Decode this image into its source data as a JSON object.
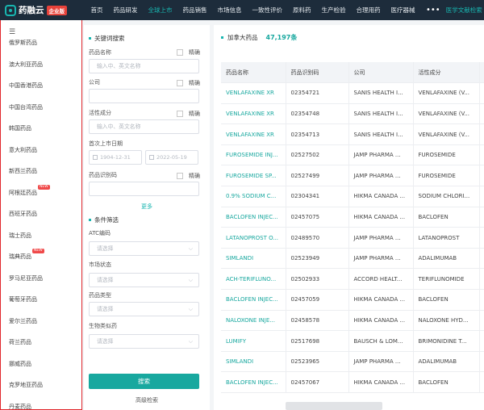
{
  "app": {
    "logo_text": "药融云",
    "logo_badge": "企业版"
  },
  "topnav": {
    "items": [
      {
        "label": "首页",
        "active": false
      },
      {
        "label": "药品研发",
        "active": false
      },
      {
        "label": "全球上市",
        "active": true
      },
      {
        "label": "药品销售",
        "active": false
      },
      {
        "label": "市场信息",
        "active": false
      },
      {
        "label": "一致性评价",
        "active": false
      },
      {
        "label": "原料药",
        "active": false
      },
      {
        "label": "生产检验",
        "active": false
      },
      {
        "label": "合理用药",
        "active": false
      },
      {
        "label": "医疗器械",
        "active": false
      }
    ],
    "more": "•••",
    "right_link": "医学文献检索"
  },
  "sidebar": {
    "menu_icon": "menu-icon",
    "countries": [
      {
        "label": "俄罗斯药品",
        "new": false
      },
      {
        "label": "澳大利亚药品",
        "new": false
      },
      {
        "label": "中国香港药品",
        "new": false
      },
      {
        "label": "中国台湾药品",
        "new": false
      },
      {
        "label": "韩国药品",
        "new": false
      },
      {
        "label": "意大利药品",
        "new": false
      },
      {
        "label": "新西兰药品",
        "new": false
      },
      {
        "label": "阿根廷药品",
        "new": true
      },
      {
        "label": "西班牙药品",
        "new": false
      },
      {
        "label": "瑞士药品",
        "new": false
      },
      {
        "label": "瑞典药品",
        "new": true
      },
      {
        "label": "罗马尼亚药品",
        "new": false
      },
      {
        "label": "葡萄牙药品",
        "new": false
      },
      {
        "label": "爱尔兰药品",
        "new": false
      },
      {
        "label": "荷兰药品",
        "new": false
      },
      {
        "label": "挪威药品",
        "new": false
      },
      {
        "label": "克罗地亚药品",
        "new": false
      },
      {
        "label": "丹麦药品",
        "new": false
      }
    ],
    "new_badge": "NEW"
  },
  "search": {
    "keyword_heading": "关键词搜索",
    "exact_label": "精确",
    "drug_name_label": "药品名称",
    "drug_name_placeholder": "输入中、英文名称",
    "company_label": "公司",
    "company_value": "",
    "ingredient_label": "活性成分",
    "ingredient_placeholder": "输入中、英文名称",
    "first_listing_label": "首次上市日期",
    "date_from": "1904-12-31",
    "date_to": "2022-05-19",
    "drug_id_label": "药品识别码",
    "drug_id_value": "",
    "more_label": "更多",
    "filter_heading": "条件筛选",
    "atc_label": "ATC编码",
    "market_status_label": "市场状态",
    "drug_type_label": "药品类型",
    "biosimilar_label": "生物类似药",
    "select_placeholder": "请选择",
    "search_button": "搜索",
    "advanced_link": "高级检索"
  },
  "results": {
    "title": "加拿大药品",
    "count": "47,197条",
    "columns": [
      "药品名称",
      "药品识别码",
      "公司",
      "活性成分"
    ],
    "rows": [
      [
        "VENLAFAXINE XR",
        "02354721",
        "SANIS HEALTH I...",
        "VENLAFAXINE (V..."
      ],
      [
        "VENLAFAXINE XR",
        "02354748",
        "SANIS HEALTH I...",
        "VENLAFAXINE (V..."
      ],
      [
        "VENLAFAXINE XR",
        "02354713",
        "SANIS HEALTH I...",
        "VENLAFAXINE (V..."
      ],
      [
        "FUROSEMIDE INJ...",
        "02527502",
        "JAMP PHARMA ...",
        "FUROSEMIDE"
      ],
      [
        "FUROSEMIDE SP...",
        "02527499",
        "JAMP PHARMA ...",
        "FUROSEMIDE"
      ],
      [
        "0.9% SODIUM C...",
        "02304341",
        "HIKMA CANADA ...",
        "SODIUM CHLORI..."
      ],
      [
        "BACLOFEN INJEC...",
        "02457075",
        "HIKMA CANADA ...",
        "BACLOFEN"
      ],
      [
        "LATANOPROST O...",
        "02489570",
        "JAMP PHARMA ...",
        "LATANOPROST"
      ],
      [
        "SIMLANDI",
        "02523949",
        "JAMP PHARMA ...",
        "ADALIMUMAB"
      ],
      [
        "ACH-TERIFLUNO...",
        "02502933",
        "ACCORD HEALT...",
        "TERIFLUNOMIDE"
      ],
      [
        "BACLOFEN INJEC...",
        "02457059",
        "HIKMA CANADA ...",
        "BACLOFEN"
      ],
      [
        "NALOXONE INJE...",
        "02458578",
        "HIKMA CANADA ...",
        "NALOXONE HYD..."
      ],
      [
        "LUMIFY",
        "02517698",
        "BAUSCH & LOM...",
        "BRIMONIDINE T..."
      ],
      [
        "SIMLANDI",
        "02523965",
        "JAMP PHARMA ...",
        "ADALIMUMAB"
      ],
      [
        "BACLOFEN INJEC...",
        "02457067",
        "HIKMA CANADA ...",
        "BACLOFEN"
      ]
    ]
  },
  "colors": {
    "nav_bg": "#1d2c3b",
    "accent": "#18b6b0",
    "highlight_border": "#e0262c"
  }
}
